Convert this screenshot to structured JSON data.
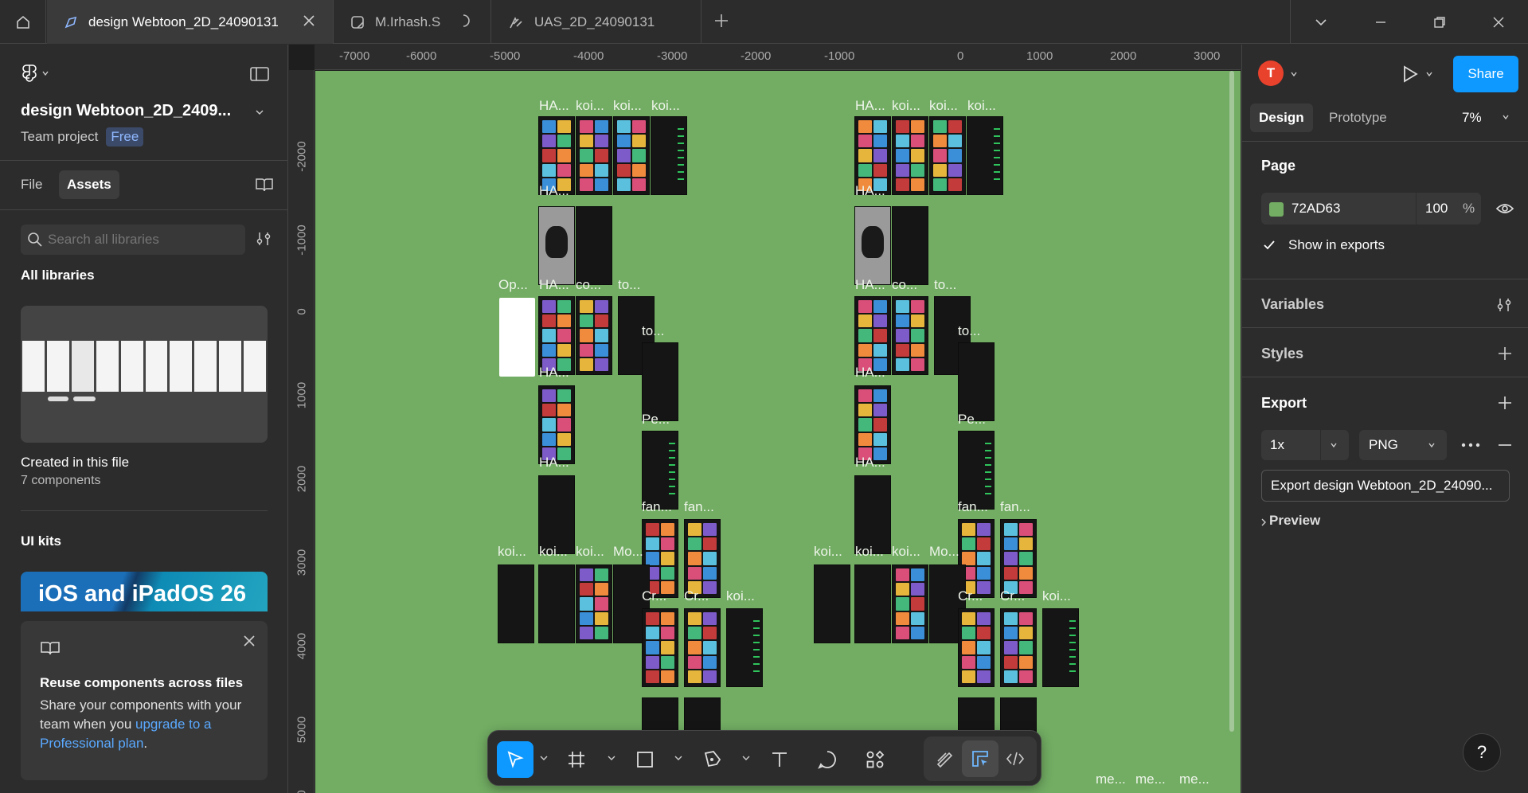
{
  "tabs": [
    {
      "label": "design Webtoon_2D_24090131",
      "active": true
    },
    {
      "label": "M.Irhash.S",
      "active": false
    },
    {
      "label": "UAS_2D_24090131",
      "active": false
    }
  ],
  "left_panel": {
    "project_title": "design Webtoon_2D_2409...",
    "project_team": "Team project",
    "plan_badge": "Free",
    "tab_file": "File",
    "tab_assets": "Assets",
    "search_placeholder": "Search all libraries",
    "all_libraries": "All libraries",
    "created_title": "Created in this file",
    "created_count": "7 components",
    "ui_kits": "UI kits",
    "ios_kit": "iOS and iPadOS 26",
    "promo_title": "Reuse components across files",
    "promo_text": "Share your components with your team when you ",
    "promo_link": "upgrade to a Professional plan",
    "promo_end": "."
  },
  "rulers": {
    "top": [
      "-7000",
      "-6000",
      "-5000",
      "-4000",
      "-3000",
      "-2000",
      "-1000",
      "0",
      "1000",
      "2000",
      "3000"
    ],
    "left": [
      "-2000",
      "-1000",
      "0",
      "1000",
      "2000",
      "3000",
      "4000",
      "5000",
      "0"
    ]
  },
  "canvas": {
    "bg_color": "#72AD63",
    "labels": {
      "ha": "HA...",
      "koi": "koi...",
      "op": "Op...",
      "co": "co...",
      "to": "to...",
      "pe": "Pe...",
      "fan": "fan...",
      "mo": "Mo...",
      "cr": "Cr...",
      "me": "me..."
    }
  },
  "right_panel": {
    "avatar_letter": "T",
    "share": "Share",
    "tab_design": "Design",
    "tab_prototype": "Prototype",
    "zoom": "7%",
    "page_heading": "Page",
    "page_color_hex": "72AD63",
    "page_opacity": "100",
    "page_opacity_unit": "%",
    "show_in_exports": "Show in exports",
    "variables": "Variables",
    "styles": "Styles",
    "export": "Export",
    "export_scale": "1x",
    "export_format": "PNG",
    "export_button": "Export design Webtoon_2D_24090...",
    "preview": "Preview",
    "help": "?"
  },
  "colors": {
    "accent": "#0d99ff",
    "canvas": "#72ad63",
    "panel": "#2c2c2c"
  }
}
